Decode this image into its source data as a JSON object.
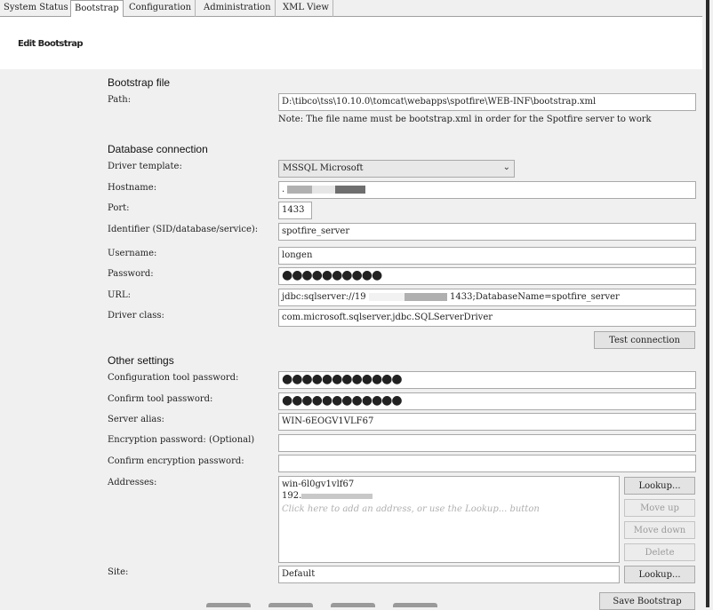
{
  "tabs": [
    {
      "label": "System Status",
      "active": false
    },
    {
      "label": "Bootstrap",
      "active": true
    },
    {
      "label": "Configuration",
      "active": false
    },
    {
      "label": "Administration",
      "active": false
    },
    {
      "label": "XML View",
      "active": false
    }
  ],
  "page_title": "Edit Bootstrap",
  "bootstrap_file": {
    "heading": "Bootstrap file",
    "path_label": "Path:",
    "path_value": "D:\\tibco\\tss\\10.10.0\\tomcat\\webapps\\spotfire\\WEB-INF\\bootstrap.xml",
    "note": "Note: The file name must be bootstrap.xml in order for the Spotfire server to work"
  },
  "database": {
    "heading": "Database connection",
    "driver_template_label": "Driver template:",
    "driver_template_value": "MSSQL Microsoft",
    "hostname_label": "Hostname:",
    "hostname_prefix": ".",
    "port_label": "Port:",
    "port_value": "1433",
    "identifier_label": "Identifier (SID/database/service):",
    "identifier_value": "spotfire_server",
    "username_label": "Username:",
    "username_value": "longen",
    "password_label": "Password:",
    "password_value": "●●●●●●●●●●",
    "url_label": "URL:",
    "url_prefix": "jdbc:sqlserver://19",
    "url_suffix": "1433;DatabaseName=spotfire_server",
    "driver_class_label": "Driver class:",
    "driver_class_value": "com.microsoft.sqlserver.jdbc.SQLServerDriver",
    "test_connection_label": "Test connection"
  },
  "other": {
    "heading": "Other settings",
    "config_pw_label": "Configuration tool password:",
    "config_pw_value": "●●●●●●●●●●●●",
    "confirm_pw_label": "Confirm tool password:",
    "confirm_pw_value": "●●●●●●●●●●●●",
    "server_alias_label": "Server alias:",
    "server_alias_value": "WIN-6EOGV1VLF67",
    "enc_pw_label": "Encryption password: (Optional)",
    "enc_pw_value": "",
    "confirm_enc_label": "Confirm encryption password:",
    "confirm_enc_value": "",
    "addresses_label": "Addresses:",
    "address_1": "win-6l0gv1vlf67",
    "address_2_prefix": "192.",
    "address_hint": "Click here to add an address, or use the Lookup... button",
    "lookup_label": "Lookup...",
    "move_up_label": "Move up",
    "move_down_label": "Move down",
    "delete_label": "Delete",
    "site_label": "Site:",
    "site_value": "Default",
    "site_lookup_label": "Lookup...",
    "save_label": "Save Bootstrap"
  }
}
